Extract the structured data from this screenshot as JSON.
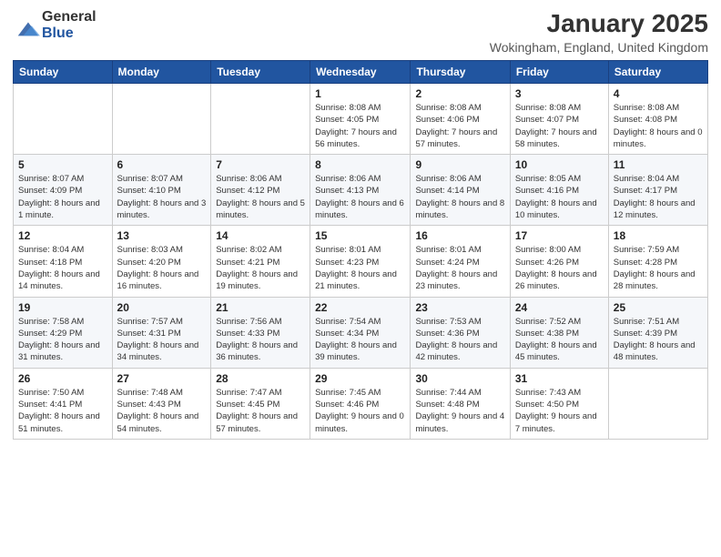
{
  "header": {
    "logo_general": "General",
    "logo_blue": "Blue",
    "month_title": "January 2025",
    "location": "Wokingham, England, United Kingdom"
  },
  "days_of_week": [
    "Sunday",
    "Monday",
    "Tuesday",
    "Wednesday",
    "Thursday",
    "Friday",
    "Saturday"
  ],
  "weeks": [
    [
      {
        "day": "",
        "info": ""
      },
      {
        "day": "",
        "info": ""
      },
      {
        "day": "",
        "info": ""
      },
      {
        "day": "1",
        "info": "Sunrise: 8:08 AM\nSunset: 4:05 PM\nDaylight: 7 hours and 56 minutes."
      },
      {
        "day": "2",
        "info": "Sunrise: 8:08 AM\nSunset: 4:06 PM\nDaylight: 7 hours and 57 minutes."
      },
      {
        "day": "3",
        "info": "Sunrise: 8:08 AM\nSunset: 4:07 PM\nDaylight: 7 hours and 58 minutes."
      },
      {
        "day": "4",
        "info": "Sunrise: 8:08 AM\nSunset: 4:08 PM\nDaylight: 8 hours and 0 minutes."
      }
    ],
    [
      {
        "day": "5",
        "info": "Sunrise: 8:07 AM\nSunset: 4:09 PM\nDaylight: 8 hours and 1 minute."
      },
      {
        "day": "6",
        "info": "Sunrise: 8:07 AM\nSunset: 4:10 PM\nDaylight: 8 hours and 3 minutes."
      },
      {
        "day": "7",
        "info": "Sunrise: 8:06 AM\nSunset: 4:12 PM\nDaylight: 8 hours and 5 minutes."
      },
      {
        "day": "8",
        "info": "Sunrise: 8:06 AM\nSunset: 4:13 PM\nDaylight: 8 hours and 6 minutes."
      },
      {
        "day": "9",
        "info": "Sunrise: 8:06 AM\nSunset: 4:14 PM\nDaylight: 8 hours and 8 minutes."
      },
      {
        "day": "10",
        "info": "Sunrise: 8:05 AM\nSunset: 4:16 PM\nDaylight: 8 hours and 10 minutes."
      },
      {
        "day": "11",
        "info": "Sunrise: 8:04 AM\nSunset: 4:17 PM\nDaylight: 8 hours and 12 minutes."
      }
    ],
    [
      {
        "day": "12",
        "info": "Sunrise: 8:04 AM\nSunset: 4:18 PM\nDaylight: 8 hours and 14 minutes."
      },
      {
        "day": "13",
        "info": "Sunrise: 8:03 AM\nSunset: 4:20 PM\nDaylight: 8 hours and 16 minutes."
      },
      {
        "day": "14",
        "info": "Sunrise: 8:02 AM\nSunset: 4:21 PM\nDaylight: 8 hours and 19 minutes."
      },
      {
        "day": "15",
        "info": "Sunrise: 8:01 AM\nSunset: 4:23 PM\nDaylight: 8 hours and 21 minutes."
      },
      {
        "day": "16",
        "info": "Sunrise: 8:01 AM\nSunset: 4:24 PM\nDaylight: 8 hours and 23 minutes."
      },
      {
        "day": "17",
        "info": "Sunrise: 8:00 AM\nSunset: 4:26 PM\nDaylight: 8 hours and 26 minutes."
      },
      {
        "day": "18",
        "info": "Sunrise: 7:59 AM\nSunset: 4:28 PM\nDaylight: 8 hours and 28 minutes."
      }
    ],
    [
      {
        "day": "19",
        "info": "Sunrise: 7:58 AM\nSunset: 4:29 PM\nDaylight: 8 hours and 31 minutes."
      },
      {
        "day": "20",
        "info": "Sunrise: 7:57 AM\nSunset: 4:31 PM\nDaylight: 8 hours and 34 minutes."
      },
      {
        "day": "21",
        "info": "Sunrise: 7:56 AM\nSunset: 4:33 PM\nDaylight: 8 hours and 36 minutes."
      },
      {
        "day": "22",
        "info": "Sunrise: 7:54 AM\nSunset: 4:34 PM\nDaylight: 8 hours and 39 minutes."
      },
      {
        "day": "23",
        "info": "Sunrise: 7:53 AM\nSunset: 4:36 PM\nDaylight: 8 hours and 42 minutes."
      },
      {
        "day": "24",
        "info": "Sunrise: 7:52 AM\nSunset: 4:38 PM\nDaylight: 8 hours and 45 minutes."
      },
      {
        "day": "25",
        "info": "Sunrise: 7:51 AM\nSunset: 4:39 PM\nDaylight: 8 hours and 48 minutes."
      }
    ],
    [
      {
        "day": "26",
        "info": "Sunrise: 7:50 AM\nSunset: 4:41 PM\nDaylight: 8 hours and 51 minutes."
      },
      {
        "day": "27",
        "info": "Sunrise: 7:48 AM\nSunset: 4:43 PM\nDaylight: 8 hours and 54 minutes."
      },
      {
        "day": "28",
        "info": "Sunrise: 7:47 AM\nSunset: 4:45 PM\nDaylight: 8 hours and 57 minutes."
      },
      {
        "day": "29",
        "info": "Sunrise: 7:45 AM\nSunset: 4:46 PM\nDaylight: 9 hours and 0 minutes."
      },
      {
        "day": "30",
        "info": "Sunrise: 7:44 AM\nSunset: 4:48 PM\nDaylight: 9 hours and 4 minutes."
      },
      {
        "day": "31",
        "info": "Sunrise: 7:43 AM\nSunset: 4:50 PM\nDaylight: 9 hours and 7 minutes."
      },
      {
        "day": "",
        "info": ""
      }
    ]
  ]
}
